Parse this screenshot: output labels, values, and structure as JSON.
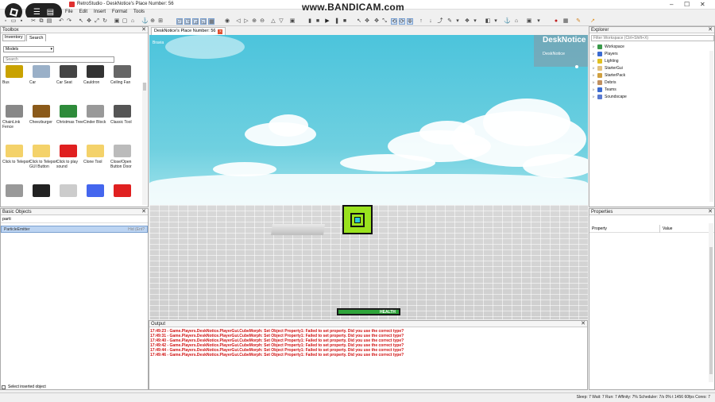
{
  "window": {
    "title": "RetroStudio - DeskNotice's Place Number: 56",
    "watermark": "www.BANDICAM.com"
  },
  "menu": [
    "File",
    "Edit",
    "Insert",
    "Format",
    "Tools"
  ],
  "tab": {
    "label": "DeskNotice's Place Number: 56"
  },
  "toolbox": {
    "title": "Toolbox",
    "tabs": [
      "Inventory",
      "Search"
    ],
    "category": "Models",
    "search_placeholder": "Search",
    "items": [
      {
        "label": "Bus",
        "color": "#c9a200"
      },
      {
        "label": "Car",
        "color": "#9ab0c8"
      },
      {
        "label": "Car Seat",
        "color": "#444"
      },
      {
        "label": "Cauldron",
        "color": "#333"
      },
      {
        "label": "Ceiling Fan",
        "color": "#666"
      },
      {
        "label": "ChainLink Fence",
        "color": "#888"
      },
      {
        "label": "Cheezburger",
        "color": "#8b5a1a"
      },
      {
        "label": "Christmas Tree",
        "color": "#2e8b3a"
      },
      {
        "label": "Cinder Block",
        "color": "#999"
      },
      {
        "label": "Classic Tool",
        "color": "#555"
      },
      {
        "label": "Click to Teleport",
        "color": "#f4d26a"
      },
      {
        "label": "Click to Teleport GUI Button",
        "color": "#f4d26a"
      },
      {
        "label": "Click to play sound",
        "color": "#e02020"
      },
      {
        "label": "Clone Tool",
        "color": "#f4d26a"
      },
      {
        "label": "Close/Open Button Door",
        "color": "#bbb"
      },
      {
        "label": "",
        "color": "#999"
      },
      {
        "label": "",
        "color": "#222"
      },
      {
        "label": "",
        "color": "#ccc"
      },
      {
        "label": "",
        "color": "#4466ee"
      },
      {
        "label": "",
        "color": "#e02020"
      }
    ]
  },
  "basic_objects": {
    "title": "Basic Objects",
    "search_value": "parti",
    "items": [
      {
        "label": "ParticleEmitter",
        "hint": "Hid (Ent?"
      }
    ],
    "select_inserted_label": "Select inserted object"
  },
  "viewport": {
    "corner_label": "Bravia",
    "player_name_title": "DeskNotice",
    "player_name_small": "DeskNotice",
    "health_label": "HEALTH",
    "health": 1.0
  },
  "explorer": {
    "title": "Explorer",
    "filter_placeholder": "Filter Workspace (Ctrl+Shift+X)",
    "items": [
      {
        "label": "Workspace",
        "color": "#3a9a4a"
      },
      {
        "label": "Players",
        "color": "#3a6ad0"
      },
      {
        "label": "Lighting",
        "color": "#e0c020"
      },
      {
        "label": "StarterGui",
        "color": "#e0c080"
      },
      {
        "label": "StarterPack",
        "color": "#d0a040"
      },
      {
        "label": "Debris",
        "color": "#c09060"
      },
      {
        "label": "Teams",
        "color": "#3a6ad0"
      },
      {
        "label": "Soundscape",
        "color": "#5a7ad0"
      }
    ]
  },
  "properties": {
    "title": "Properties",
    "col_property": "Property",
    "col_value": "Value"
  },
  "output": {
    "title": "Output",
    "lines": [
      "17:49:23 - Game.Players.DeskNotice.PlayerGui.CubeMorph: Set Object Property1: Failed to set property. Did you use the correct type?",
      "17:49:31 - Game.Players.DeskNotice.PlayerGui.CubeMorph: Set Object Property1: Failed to set property. Did you use the correct type?",
      "17:49:40 - Game.Players.DeskNotice.PlayerGui.CubeMorph: Set Object Property1: Failed to set property. Did you use the correct type?",
      "17:49:42 - Game.Players.DeskNotice.PlayerGui.CubeMorph: Set Object Property1: Failed to set property. Did you use the correct type?",
      "17:49:44 - Game.Players.DeskNotice.PlayerGui.CubeMorph: Set Object Property1: Failed to set property. Did you use the correct type?",
      "17:49:46 - Game.Players.DeskNotice.PlayerGui.CubeMorph: Set Object Property1: Failed to set property. Did you use the correct type?"
    ]
  },
  "status": "Sleep: 7 Wait: 7 Run: 7 Affinity: 7% Scheduler: 7/s 0%   t 1456   60fps   Cores: 7"
}
